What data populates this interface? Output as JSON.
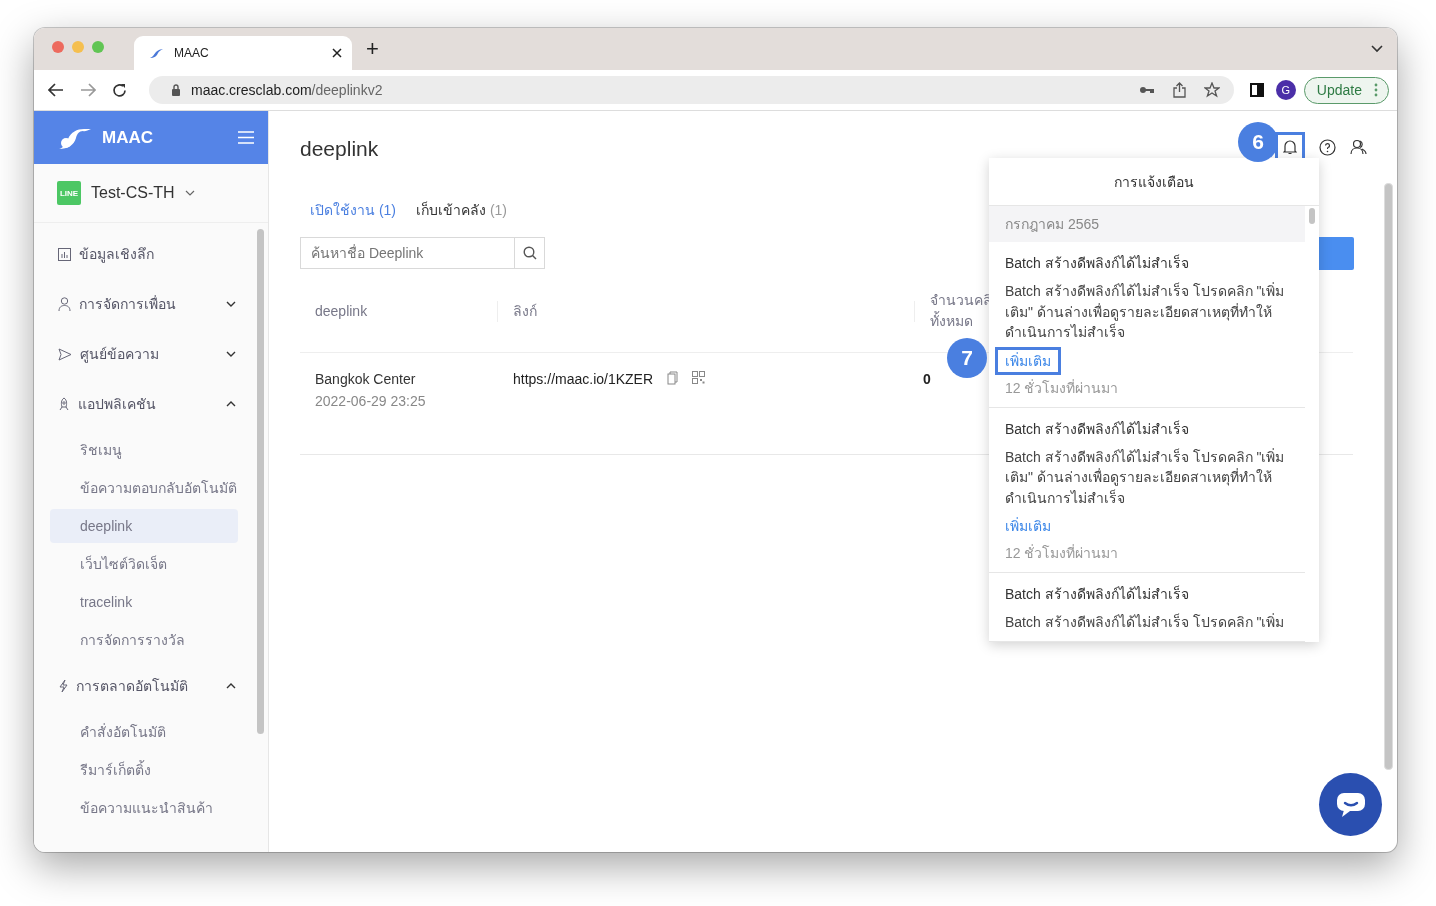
{
  "browser": {
    "tab_title": "MAAC",
    "new_tab": "+",
    "url_host": "maac.cresclab.com",
    "url_path": "/deeplinkv2",
    "profile_initial": "G",
    "update_label": "Update"
  },
  "sidebar": {
    "brand": "MAAC",
    "account_badge": "LINE",
    "account": "Test-CS-TH",
    "items": [
      {
        "label": "ข้อมูลเชิงลึก",
        "kind": "link",
        "selected": false
      },
      {
        "label": "การจัดการเพื่อน",
        "kind": "group",
        "expanded": false,
        "selected": false
      },
      {
        "label": "ศูนย์ข้อความ",
        "kind": "group",
        "expanded": false,
        "selected": false
      },
      {
        "label": "แอปพลิเคชัน",
        "kind": "group",
        "expanded": true,
        "selected": false,
        "children": [
          {
            "label": "ริชเมนู",
            "selected": false
          },
          {
            "label": "ข้อความตอบกลับอัตโนมัติ",
            "selected": false
          },
          {
            "label": "deeplink",
            "selected": true
          },
          {
            "label": "เว็บไซต์วิดเจ็ต",
            "selected": false
          },
          {
            "label": "tracelink",
            "selected": false
          },
          {
            "label": "การจัดการรางวัล",
            "selected": false
          }
        ]
      },
      {
        "label": "การตลาดอัตโนมัติ",
        "kind": "group",
        "expanded": true,
        "selected": false,
        "children": [
          {
            "label": "คำสั่งอัตโนมัติ",
            "selected": false
          },
          {
            "label": "รีมาร์เก็ตติ้ง",
            "selected": false
          },
          {
            "label": "ข้อความแนะนำสินค้า",
            "selected": false
          }
        ]
      }
    ]
  },
  "page": {
    "title": "deeplink",
    "tabs": [
      {
        "label": "เปิดใช้งาน",
        "count": "(1)",
        "selected": true
      },
      {
        "label": "เก็บเข้าคลัง",
        "count": "(1)",
        "selected": false
      }
    ],
    "search": {
      "placeholder": "ค้นหาชื่อ Deeplink"
    },
    "table": {
      "columns": [
        {
          "lines": [
            "deeplink"
          ]
        },
        {
          "lines": [
            "ลิงก์"
          ]
        },
        {
          "lines": [
            "จำนวนคลิ",
            "ทั้งหมด"
          ]
        }
      ],
      "rows": [
        {
          "name": "Bangkok Center",
          "date": "2022-06-29 23:25",
          "link": "https://maac.io/1KZER",
          "clicks": "0"
        }
      ]
    }
  },
  "notifications": {
    "title": "การแจ้งเตือน",
    "highlighted": true,
    "month": "กรกฎาคม 2565",
    "items": [
      {
        "title": "Batch สร้างดีพลิงก์ได้ไม่สำเร็จ",
        "body": "Batch สร้างดีพลิงก์ได้ไม่สำเร็จ โปรดคลิก \"เพิ่มเติม\" ด้านล่างเพื่อดูรายละเอียดสาเหตุที่ทำให้ดำเนินการไม่สำเร็จ",
        "more": "เพิ่มเติม",
        "more_highlighted": true,
        "time": "12 ชั่วโมงที่ผ่านมา"
      },
      {
        "title": "Batch สร้างดีพลิงก์ได้ไม่สำเร็จ",
        "body": "Batch สร้างดีพลิงก์ได้ไม่สำเร็จ โปรดคลิก \"เพิ่มเติม\" ด้านล่างเพื่อดูรายละเอียดสาเหตุที่ทำให้ดำเนินการไม่สำเร็จ",
        "more": "เพิ่มเติม",
        "more_highlighted": false,
        "time": "12 ชั่วโมงที่ผ่านมา"
      },
      {
        "title": "Batch สร้างดีพลิงก์ได้ไม่สำเร็จ",
        "body": "Batch สร้างดีพลิงก์ได้ไม่สำเร็จ โปรดคลิก \"เพิ่ม"
      }
    ]
  },
  "callouts": [
    {
      "number": "6"
    },
    {
      "number": "7"
    }
  ]
}
